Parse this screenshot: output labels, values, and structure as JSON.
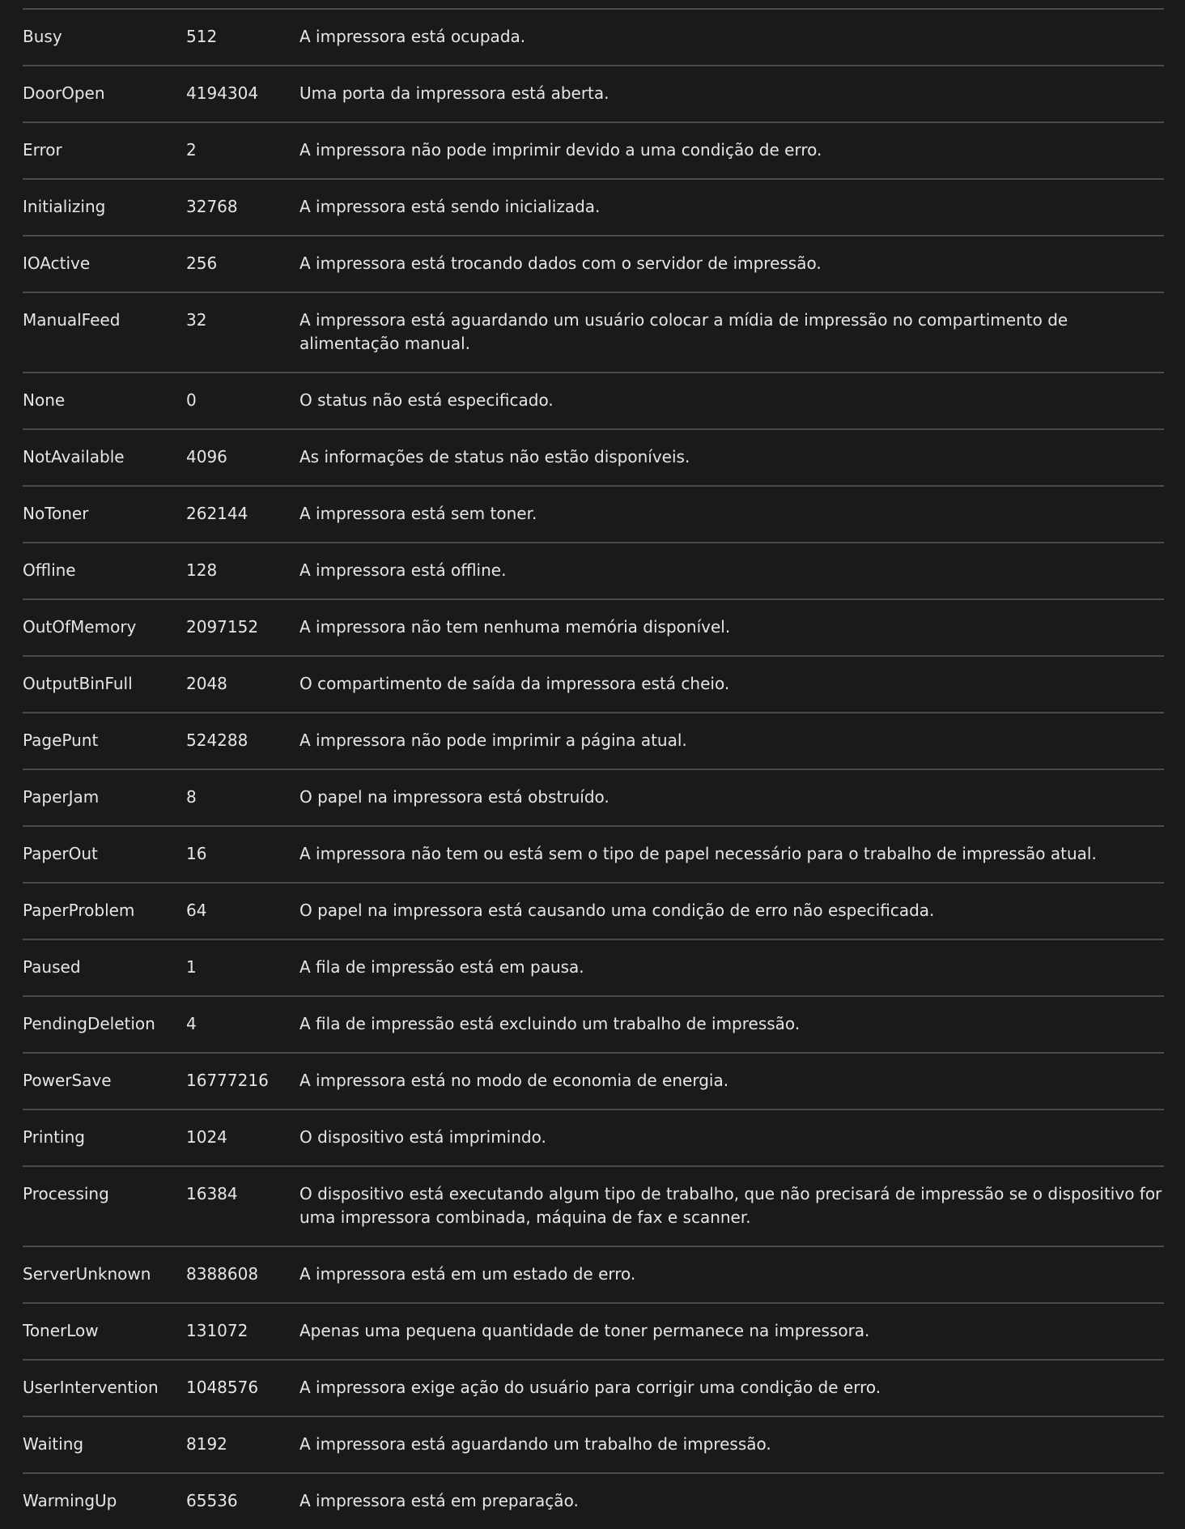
{
  "table": {
    "rows": [
      {
        "name": "Busy",
        "value": "512",
        "description": "A impressora está ocupada."
      },
      {
        "name": "DoorOpen",
        "value": "4194304",
        "description": "Uma porta da impressora está aberta."
      },
      {
        "name": "Error",
        "value": "2",
        "description": "A impressora não pode imprimir devido a uma condição de erro."
      },
      {
        "name": "Initializing",
        "value": "32768",
        "description": "A impressora está sendo inicializada."
      },
      {
        "name": "IOActive",
        "value": "256",
        "description": "A impressora está trocando dados com o servidor de impressão."
      },
      {
        "name": "ManualFeed",
        "value": "32",
        "description": "A impressora está aguardando um usuário colocar a mídia de impressão no compartimento de alimentação manual."
      },
      {
        "name": "None",
        "value": "0",
        "description": "O status não está especificado."
      },
      {
        "name": "NotAvailable",
        "value": "4096",
        "description": "As informações de status não estão disponíveis."
      },
      {
        "name": "NoToner",
        "value": "262144",
        "description": "A impressora está sem toner."
      },
      {
        "name": "Offline",
        "value": "128",
        "description": "A impressora está offline."
      },
      {
        "name": "OutOfMemory",
        "value": "2097152",
        "description": "A impressora não tem nenhuma memória disponível."
      },
      {
        "name": "OutputBinFull",
        "value": "2048",
        "description": "O compartimento de saída da impressora está cheio."
      },
      {
        "name": "PagePunt",
        "value": "524288",
        "description": "A impressora não pode imprimir a página atual."
      },
      {
        "name": "PaperJam",
        "value": "8",
        "description": "O papel na impressora está obstruído."
      },
      {
        "name": "PaperOut",
        "value": "16",
        "description": "A impressora não tem ou está sem o tipo de papel necessário para o trabalho de impressão atual."
      },
      {
        "name": "PaperProblem",
        "value": "64",
        "description": "O papel na impressora está causando uma condição de erro não especificada."
      },
      {
        "name": "Paused",
        "value": "1",
        "description": "A fila de impressão está em pausa."
      },
      {
        "name": "PendingDeletion",
        "value": "4",
        "description": "A fila de impressão está excluindo um trabalho de impressão."
      },
      {
        "name": "PowerSave",
        "value": "16777216",
        "description": "A impressora está no modo de economia de energia."
      },
      {
        "name": "Printing",
        "value": "1024",
        "description": "O dispositivo está imprimindo."
      },
      {
        "name": "Processing",
        "value": "16384",
        "description": "O dispositivo está executando algum tipo de trabalho, que não precisará de impressão se o dispositivo for uma impressora combinada, máquina de fax e scanner."
      },
      {
        "name": "ServerUnknown",
        "value": "8388608",
        "description": "A impressora está em um estado de erro."
      },
      {
        "name": "TonerLow",
        "value": "131072",
        "description": "Apenas uma pequena quantidade de toner permanece na impressora."
      },
      {
        "name": "UserIntervention",
        "value": "1048576",
        "description": "A impressora exige ação do usuário para corrigir uma condição de erro."
      },
      {
        "name": "Waiting",
        "value": "8192",
        "description": "A impressora está aguardando um trabalho de impressão."
      },
      {
        "name": "WarmingUp",
        "value": "65536",
        "description": "A impressora está em preparação."
      }
    ]
  }
}
